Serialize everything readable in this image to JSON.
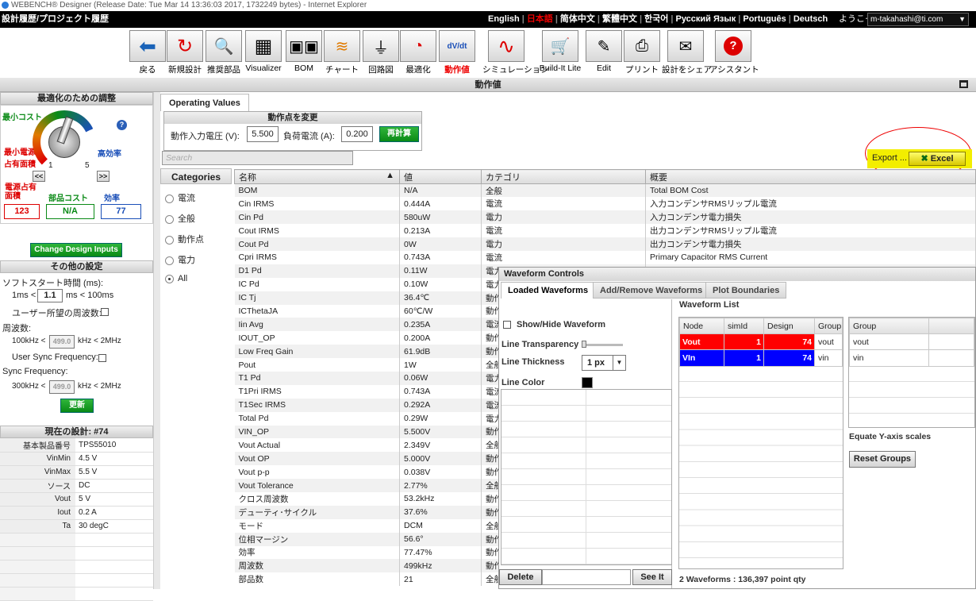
{
  "window": {
    "title": "WEBENCH® Designer (Release Date: Tue Mar 14 13:36:03 2017, 1732249 bytes) - Internet Explorer"
  },
  "topbar": {
    "left": "設計履歴/プロジェクト履歴",
    "langs": [
      "English",
      "日本語",
      "简体中文",
      "繁體中文",
      "한국어",
      "Русский Язык",
      "Português",
      "Deutsch"
    ],
    "welcome": "ようこそ",
    "user": "m-takahashi@ti.com"
  },
  "toolbar": [
    {
      "id": "back",
      "label": "戻る",
      "icon": "⬅"
    },
    {
      "id": "new",
      "label": "新規設計",
      "icon": "↻"
    },
    {
      "id": "parts",
      "label": "推奨部品",
      "icon": "🔍"
    },
    {
      "id": "visualizer",
      "label": "Visualizer",
      "icon": "▦"
    },
    {
      "id": "bom",
      "label": "BOM",
      "icon": "▣"
    },
    {
      "id": "chart",
      "label": "チャート",
      "icon": "≋"
    },
    {
      "id": "schematic",
      "label": "回路図",
      "icon": "⏚"
    },
    {
      "id": "optimize",
      "label": "最適化",
      "icon": "◔"
    },
    {
      "id": "opvals",
      "label": "動作値",
      "icon": "dV/dt"
    },
    {
      "id": "sim",
      "label": "シミュレーション",
      "icon": "∿"
    },
    {
      "id": "buildit",
      "label": "Build-It Lite",
      "icon": "🛒"
    },
    {
      "id": "edit",
      "label": "Edit",
      "icon": "✎"
    },
    {
      "id": "print",
      "label": "プリント",
      "icon": "⎙"
    },
    {
      "id": "share",
      "label": "設計をシェア",
      "icon": "✉"
    },
    {
      "id": "assistant",
      "label": "アシスタント",
      "icon": "?"
    }
  ],
  "header": {
    "title": "動作値"
  },
  "left": {
    "opt_title": "最適化のための調整",
    "min_cost": "最小コスト",
    "min_area": "最小電源\n占有面積",
    "high_eff": "高効率",
    "dial_1": "1",
    "dial_5": "5",
    "prev": "<<",
    "next": ">>",
    "metric_labels": [
      "電源占有\n面積",
      "部品コスト",
      "効率"
    ],
    "metric_values": [
      "123",
      "N/A",
      "77"
    ],
    "change_btn": "Change Design Inputs",
    "other_title": "その他の設定",
    "soft_start": "ソフトスタート時間 (ms):",
    "ss_min": "1ms <",
    "ss_val": "1.1",
    "ss_max": "ms < 100ms",
    "user_freq": "ユーザー所望の周波数:",
    "freq_label": "周波数:",
    "freq_min": "100kHz <",
    "freq_val": "499.0",
    "freq_max": "kHz < 2MHz",
    "user_sync": "User Sync Frequency:",
    "sync_label": "Sync Frequency:",
    "sync_min": "300kHz <",
    "sync_val": "499.0",
    "sync_max": "kHz < 2MHz",
    "update_btn": "更新",
    "current_title": "現在の設計: #74",
    "design": [
      [
        "基本製品番号",
        "TPS55010"
      ],
      [
        "VinMin",
        "4.5 V"
      ],
      [
        "VinMax",
        "5.5 V"
      ],
      [
        "ソース",
        "DC"
      ],
      [
        "Vout",
        "5 V"
      ],
      [
        "Iout",
        "0.2 A"
      ],
      [
        "Ta",
        "30 degC"
      ]
    ]
  },
  "main": {
    "tab": "Operating Values",
    "op_title": "動作点を変更",
    "vin_label": "動作入力電圧 (V):",
    "vin": "5.500",
    "iout_label": "負荷電流 (A):",
    "iout": "0.200",
    "recalc": "再計算",
    "search_placeholder": "Search",
    "export_label": "Export ...",
    "excel": "Excel",
    "cat_title": "Categories",
    "categories": [
      "電流",
      "全般",
      "動作点",
      "電力",
      "All"
    ],
    "columns": [
      "名称",
      "値",
      "カテゴリ",
      "概要"
    ],
    "rows": [
      [
        "BOM",
        "N/A",
        "全般",
        "Total BOM Cost"
      ],
      [
        "Cin IRMS",
        "0.444A",
        "電流",
        "入力コンデンサRMSリップル電流"
      ],
      [
        "Cin Pd",
        "580uW",
        "電力",
        "入力コンデンサ電力損失"
      ],
      [
        "Cout IRMS",
        "0.213A",
        "電流",
        "出力コンデンサRMSリップル電流"
      ],
      [
        "Cout Pd",
        "0W",
        "電力",
        "出力コンデンサ電力損失"
      ],
      [
        "Cpri IRMS",
        "0.743A",
        "電流",
        "Primary Capacitor RMS Current"
      ],
      [
        "D1 Pd",
        "0.11W",
        "電力",
        ""
      ],
      [
        "IC Pd",
        "0.10W",
        "電力",
        ""
      ],
      [
        "IC Tj",
        "36.4℃",
        "動作",
        ""
      ],
      [
        "ICThetaJA",
        "60℃/W",
        "動作",
        ""
      ],
      [
        "Iin Avg",
        "0.235A",
        "電流",
        ""
      ],
      [
        "IOUT_OP",
        "0.200A",
        "動作",
        ""
      ],
      [
        "Low Freq Gain",
        "61.9dB",
        "動作",
        ""
      ],
      [
        "Pout",
        "1W",
        "全般",
        ""
      ],
      [
        "T1 Pd",
        "0.06W",
        "電力",
        ""
      ],
      [
        "T1Pri IRMS",
        "0.743A",
        "電流",
        ""
      ],
      [
        "T1Sec IRMS",
        "0.292A",
        "電流",
        ""
      ],
      [
        "Total Pd",
        "0.29W",
        "電力",
        ""
      ],
      [
        "VIN_OP",
        "5.500V",
        "動作",
        ""
      ],
      [
        "Vout Actual",
        "2.349V",
        "全般",
        ""
      ],
      [
        "Vout OP",
        "5.000V",
        "動作",
        ""
      ],
      [
        "Vout p-p",
        "0.038V",
        "動作",
        ""
      ],
      [
        "Vout Tolerance",
        "2.77%",
        "全般",
        ""
      ],
      [
        "クロス周波数",
        "53.2kHz",
        "動作",
        ""
      ],
      [
        "デューティ･サイクル",
        "37.6%",
        "動作",
        ""
      ],
      [
        "モード",
        "DCM",
        "全般",
        ""
      ],
      [
        "位相マージン",
        "56.6°",
        "動作",
        ""
      ],
      [
        "効率",
        "77.47%",
        "動作",
        ""
      ],
      [
        "周波数",
        "499kHz",
        "動作",
        ""
      ],
      [
        "部品数",
        "21",
        "全般",
        ""
      ]
    ]
  },
  "waveform": {
    "title": "Waveform Controls",
    "tabs": [
      "Loaded Waveforms",
      "Add/Remove Waveforms",
      "Plot Boundaries"
    ],
    "show_hide": "Show/Hide Waveform",
    "transparency": "Line Transparency",
    "thickness": "Line Thickness",
    "thickness_val": "1 px",
    "color": "Line Color",
    "delete": "Delete",
    "seeit": "See It",
    "list_title": "Waveform List",
    "list_cols": [
      "Node",
      "simId",
      "Design",
      "Group"
    ],
    "list_rows": [
      [
        "Vout",
        "1",
        "74",
        "vout"
      ],
      [
        "VIn",
        "1",
        "74",
        "vin"
      ]
    ],
    "row_colors": [
      "#ff0000",
      "#0000ff"
    ],
    "group_col": "Group",
    "groups": [
      "vout",
      "vin"
    ],
    "equate": "Equate Y-axis scales",
    "reset": "Reset Groups",
    "summary": "2 Waveforms : 136,397 point qty"
  }
}
